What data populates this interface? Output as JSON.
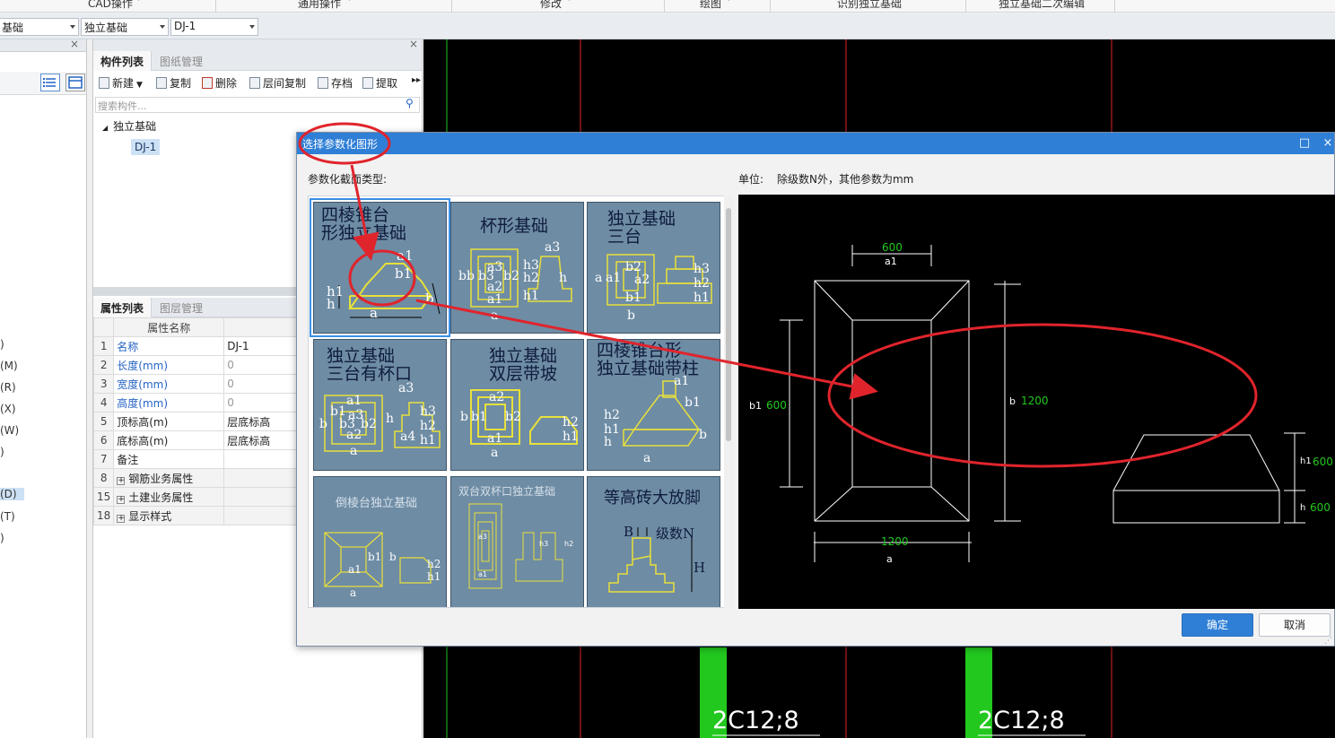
{
  "ribbon": {
    "items": [
      "CAD操作",
      "通用操作",
      "修改",
      "绘图",
      "识别独立基础",
      "独立基础二次编辑"
    ]
  },
  "toolbar": {
    "combo1": "基础",
    "combo2": "独立基础",
    "combo3": "DJ-1"
  },
  "left_pane": {
    "items": [
      ")",
      "(M)",
      "(R)",
      "(X)",
      "(W)",
      ")",
      "(D)",
      "(T)",
      ")"
    ]
  },
  "component_panel": {
    "tabs": [
      "构件列表",
      "图纸管理"
    ],
    "buttons": [
      "新建",
      "复制",
      "删除",
      "层间复制",
      "存档",
      "提取"
    ],
    "search_placeholder": "搜索构件...",
    "tree_root": "独立基础",
    "tree_child": "DJ-1"
  },
  "property_panel": {
    "tabs": [
      "属性列表",
      "图层管理"
    ],
    "header": {
      "name": "属性名称",
      "value": "属性"
    },
    "rows": [
      {
        "no": "1",
        "name": "名称",
        "value": "DJ-1"
      },
      {
        "no": "2",
        "name": "长度(mm)",
        "value": "0"
      },
      {
        "no": "3",
        "name": "宽度(mm)",
        "value": "0"
      },
      {
        "no": "4",
        "name": "高度(mm)",
        "value": "0"
      },
      {
        "no": "5",
        "name": "顶标高(m)",
        "value": "层底标高"
      },
      {
        "no": "6",
        "name": "底标高(m)",
        "value": "层底标高"
      },
      {
        "no": "7",
        "name": "备注",
        "value": ""
      },
      {
        "no": "8",
        "name": "钢筋业务属性",
        "value": ""
      },
      {
        "no": "15",
        "name": "土建业务属性",
        "value": ""
      },
      {
        "no": "18",
        "name": "显示样式",
        "value": ""
      }
    ]
  },
  "cad": {
    "labels": [
      "2C12;8",
      "2C12;8"
    ],
    "colors": {
      "green": "#22c81e",
      "red": "#e0242c",
      "background": "#000000"
    }
  },
  "dialog": {
    "title": "选择参数化图形",
    "section_label": "参数化截面类型:",
    "unit_label": "单位:",
    "unit_text": "除级数N外，其他参数为mm",
    "thumbnails": [
      {
        "caption": "四棱锥台\n形独立基础"
      },
      {
        "caption": "杯形基础"
      },
      {
        "caption": "独立基础\n三台"
      },
      {
        "caption": "独立基础\n三台有杯口"
      },
      {
        "caption": "独立基础\n双层带坡"
      },
      {
        "caption": "四棱锥台形\n独立基础带柱"
      },
      {
        "caption": "倒棱台独立基础"
      },
      {
        "caption": "双台双杯口独立基础"
      },
      {
        "caption": "等高砖大放脚"
      }
    ],
    "thumb_labels": {
      "t1": [
        "a1",
        "b1",
        "h1",
        "h",
        "a",
        "b"
      ],
      "t2": [
        "bb",
        "b3",
        "b2",
        "a3",
        "a2",
        "a1",
        "a",
        "h3",
        "h2",
        "h",
        "h1",
        "a3"
      ],
      "t3": [
        "a",
        "a1",
        "b2",
        "a2",
        "b1",
        "b",
        "h3",
        "h2",
        "h1"
      ],
      "t4": [
        "a1",
        "b1",
        "a3",
        "b3",
        "b2",
        "a2",
        "a",
        "b",
        "h",
        "a3",
        "h3",
        "h2",
        "a4",
        "h1"
      ],
      "t5": [
        "a2",
        "b",
        "b1",
        "b2",
        "a1",
        "a",
        "h2",
        "h1"
      ],
      "t6": [
        "a1",
        "b1",
        "h2",
        "h1",
        "h",
        "b",
        "a"
      ],
      "t7": [
        "b1",
        "a1",
        "a",
        "b",
        "h2",
        "h1"
      ],
      "t9": [
        "B",
        "级数N",
        "H"
      ]
    },
    "preview": {
      "a1": "a1",
      "a1_value": "600",
      "b1": "b1",
      "b1_value": "600",
      "b": "b",
      "b_value": "1200",
      "a": "a",
      "a_value": "1200",
      "h1": "h1",
      "h1_value": "600",
      "h": "h",
      "h_value": "600"
    },
    "ok": "确定",
    "cancel": "取消",
    "maximize_icon": "□",
    "close_icon": "×"
  }
}
